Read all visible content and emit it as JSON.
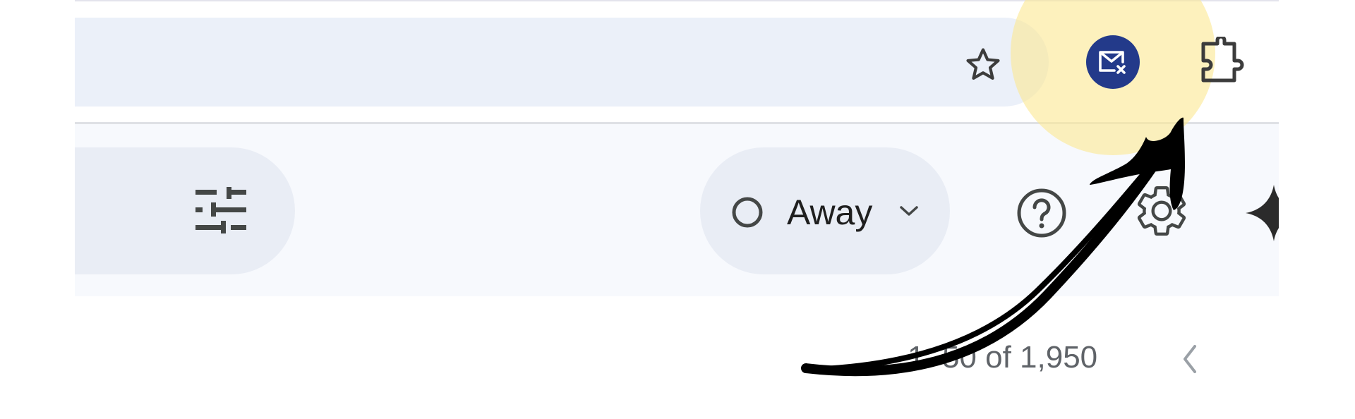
{
  "browser": {
    "icons": [
      "star-icon",
      "mail-off-icon",
      "puzzle-icon"
    ]
  },
  "toolbar": {
    "filter_icon": "tune-icon",
    "status": {
      "label": "Away",
      "icon": "circle-outline-icon"
    },
    "icons": [
      "help-icon",
      "gear-icon",
      "gemini-sparkle-icon"
    ]
  },
  "list": {
    "pagination_text": "1–50 of 1,950"
  },
  "colors": {
    "extension_badge": "#233a8a",
    "highlight": "#fce994",
    "omnibox_bg": "#ebf0f9",
    "toolbar_bg": "#f7f9fd",
    "pill_bg": "#e9edf5"
  }
}
